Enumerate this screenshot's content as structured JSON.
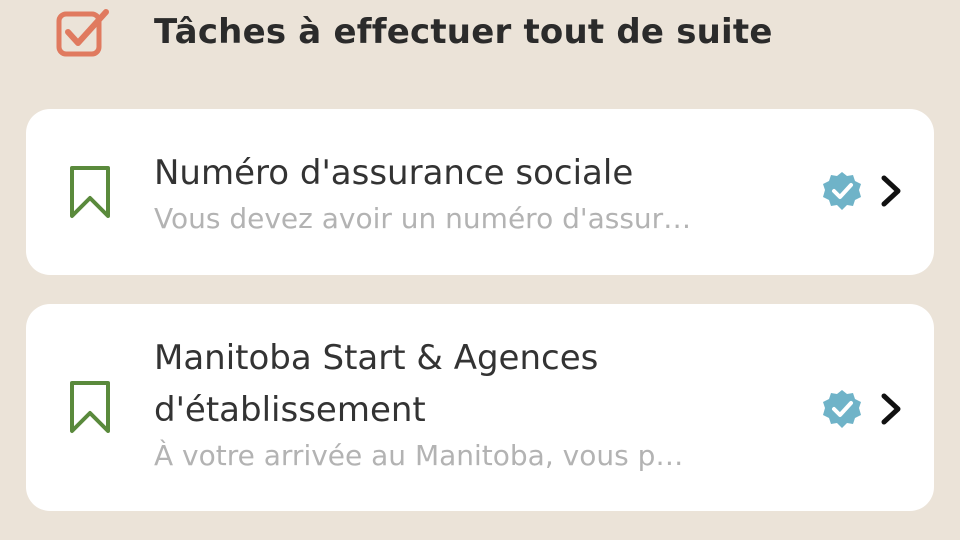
{
  "section": {
    "title": "Tâches à effectuer tout de suite"
  },
  "tasks": [
    {
      "title": "Numéro d'assurance sociale",
      "subtitle": "Vous devez avoir un numéro d'assur…",
      "icon": "bookmark-icon",
      "status_icon": "verified-badge-icon"
    },
    {
      "title": "Manitoba Start & Agences d'établissement",
      "subtitle": "À votre arrivée au Manitoba, vous p…",
      "icon": "bookmark-icon",
      "status_icon": "verified-badge-icon"
    }
  ],
  "colors": {
    "background": "#ebe3d8",
    "card": "#ffffff",
    "checkbox_accent": "#e07a5f",
    "bookmark": "#5a8a3c",
    "verified": "#6fb3c8",
    "chevron": "#111111",
    "title_text": "#333333",
    "subtitle_text": "#b3b3b3"
  }
}
